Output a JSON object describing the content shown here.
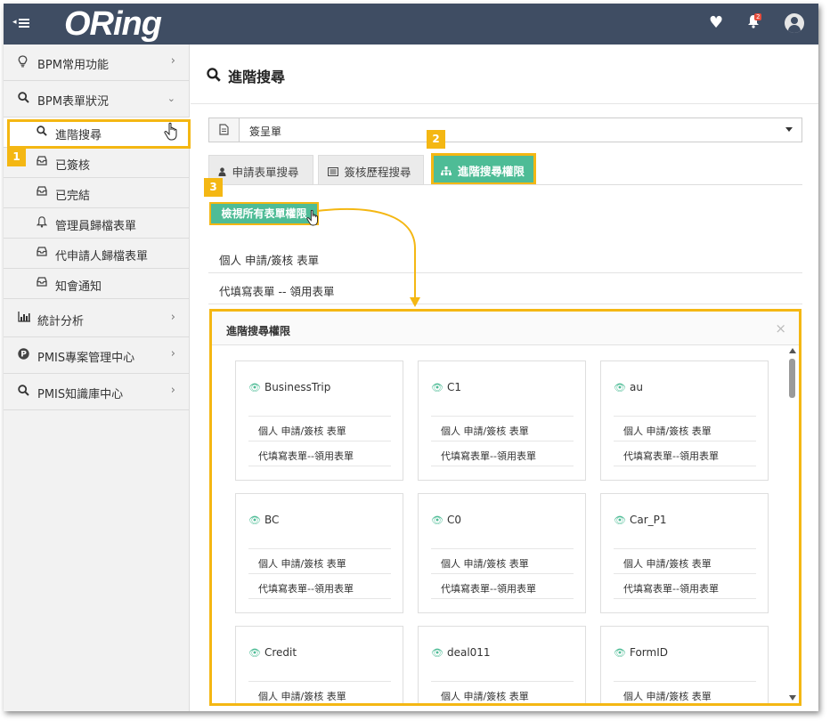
{
  "header": {
    "logo": "ORing",
    "notification_count": "2"
  },
  "sidebar": {
    "items": [
      {
        "label": "BPM常用功能",
        "icon": "lightbulb-icon"
      },
      {
        "label": "BPM表單狀況",
        "icon": "search-icon"
      },
      {
        "label": "統計分析",
        "icon": "bar-chart-icon"
      },
      {
        "label": "PMIS專案管理中心",
        "icon": "p-circle-icon"
      },
      {
        "label": "PMIS知識庫中心",
        "icon": "search-icon"
      }
    ],
    "subitems": [
      {
        "label": "進階搜尋",
        "icon": "search-icon"
      },
      {
        "label": "已簽核",
        "icon": "inbox-icon"
      },
      {
        "label": "已完結",
        "icon": "inbox-icon"
      },
      {
        "label": "管理員歸檔表單",
        "icon": "bell-icon"
      },
      {
        "label": "代申請人歸檔表單",
        "icon": "inbox-icon"
      },
      {
        "label": "知會通知",
        "icon": "inbox-icon"
      }
    ]
  },
  "main": {
    "title": "進階搜尋",
    "select_value": "簽呈單",
    "tabs": [
      {
        "label": "申請表單搜尋"
      },
      {
        "label": "簽核歷程搜尋"
      },
      {
        "label": "進階搜尋權限"
      }
    ],
    "view_all_button": "檢視所有表單權限",
    "list": [
      "個人 申請/簽核 表單",
      "代填寫表單 -- 領用表單"
    ]
  },
  "callouts": [
    "1",
    "2",
    "3"
  ],
  "modal": {
    "title": "進階搜尋權限",
    "close": "×",
    "card_line1": "個人 申請/簽核 表單",
    "card_line2": "代填寫表單--領用表單",
    "cards": [
      {
        "name": "BusinessTrip"
      },
      {
        "name": "C1"
      },
      {
        "name": "au"
      },
      {
        "name": "BC"
      },
      {
        "name": "C0"
      },
      {
        "name": "Car_P1"
      },
      {
        "name": "Credit"
      },
      {
        "name": "deal011"
      },
      {
        "name": "FormID"
      }
    ]
  },
  "colors": {
    "header_bg": "#3f4d63",
    "accent_green": "#4ebc96",
    "highlight_yellow": "#f4b713",
    "badge_red": "#e74c3c"
  }
}
